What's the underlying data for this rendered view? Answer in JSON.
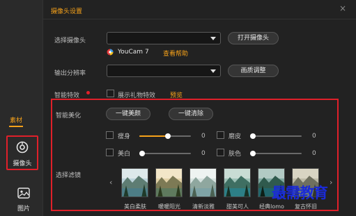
{
  "sidebar": {
    "active_tab": "素材",
    "camera_label": "摄像头",
    "picture_label": "图片"
  },
  "dialog": {
    "title": "摄像头设置",
    "close_glyph": "×",
    "select_camera_label": "选择摄像头",
    "select_camera_value": "",
    "open_camera_button": "打开摄像头",
    "camera_name": "YouCam 7",
    "help_link": "查看帮助",
    "resolution_label": "输出分辨率",
    "resolution_value": "",
    "quality_button": "画质调整",
    "effects_label": "智能特效",
    "show_gift_effects": "展示礼物特效",
    "preview_link": "预览"
  },
  "beauty": {
    "label": "智能美化",
    "one_click_beauty": "一键美颜",
    "one_click_clear": "一键清除",
    "sliders": [
      {
        "name": "瘦身",
        "value": 0,
        "fill_fraction": 0.55
      },
      {
        "name": "磨皮",
        "value": 0,
        "fill_fraction": 0.0
      },
      {
        "name": "美白",
        "value": 0,
        "fill_fraction": 0.0
      },
      {
        "name": "肤色",
        "value": 0,
        "fill_fraction": 0.0
      }
    ]
  },
  "filters": {
    "label": "选择滤镜",
    "prev_glyph": "‹",
    "next_glyph": "›",
    "items": [
      "美白柔肤",
      "暖暖阳光",
      "清新淡雅",
      "甜美可人",
      "经典lomo",
      "复古怀旧"
    ]
  },
  "watermark": "最需教育",
  "colors": {
    "accent": "#f7a21a",
    "highlight_box": "#e0202a",
    "watermark": "#1a2ad8"
  }
}
